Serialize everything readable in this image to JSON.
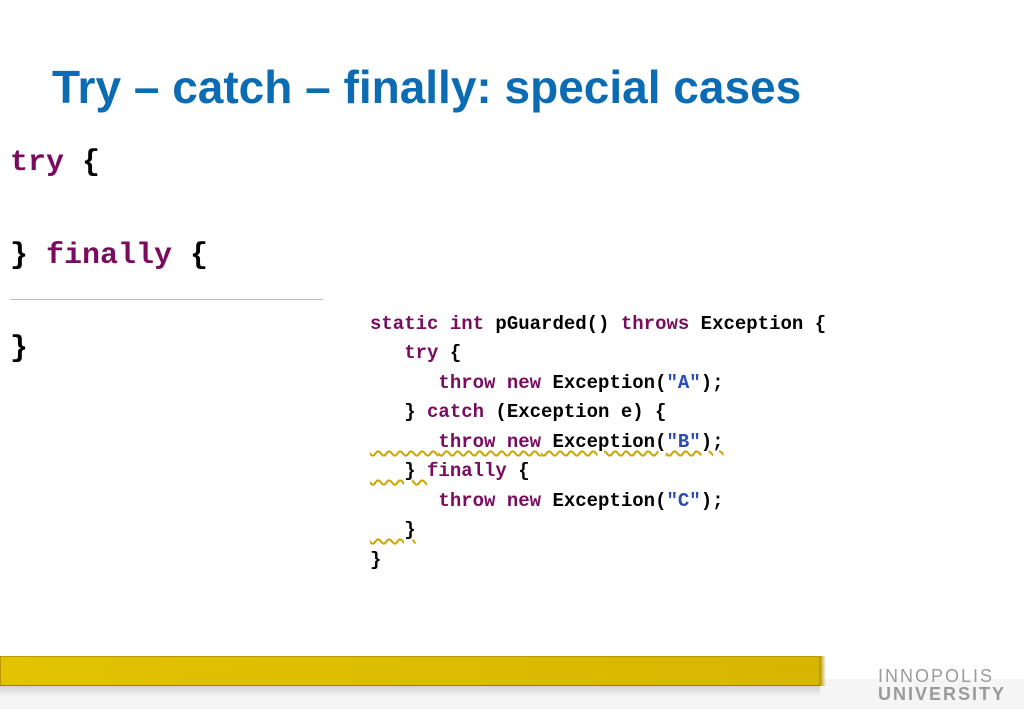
{
  "title": "Try – catch – finally: special cases",
  "code_left": {
    "l1_kw": "try",
    "l1_rest": " {",
    "l2": "",
    "l3_brace": "} ",
    "l3_kw": "finally",
    "l3_rest": " {",
    "l4": "",
    "l5": "}"
  },
  "code_right": {
    "r1_kw1": "static int",
    "r1_mid": " pGuarded() ",
    "r1_kw2": "throws",
    "r1_end": " Exception {",
    "r2_indent": "   ",
    "r2_kw": "try",
    "r2_end": " {",
    "r3_indent": "      ",
    "r3_kw": "throw new",
    "r3_mid": " Exception(",
    "r3_str": "\"A\"",
    "r3_end": ");",
    "r4_indent": "   } ",
    "r4_kw": "catch",
    "r4_end": " (Exception e) {",
    "r5_indent": "      ",
    "r5_kw": "throw new",
    "r5_mid": " Exception(",
    "r5_str": "\"B\"",
    "r5_end": ");",
    "r6_indent": "   } ",
    "r6_kw": "finally",
    "r6_end": " {",
    "r7_indent": "      ",
    "r7_kw": "throw new",
    "r7_mid": " Exception(",
    "r7_str": "\"C\"",
    "r7_end": ");",
    "r8": "   }",
    "r9": "}"
  },
  "logo": {
    "top": "INNOPOLIS",
    "bottom": "UNIVERSITY"
  }
}
